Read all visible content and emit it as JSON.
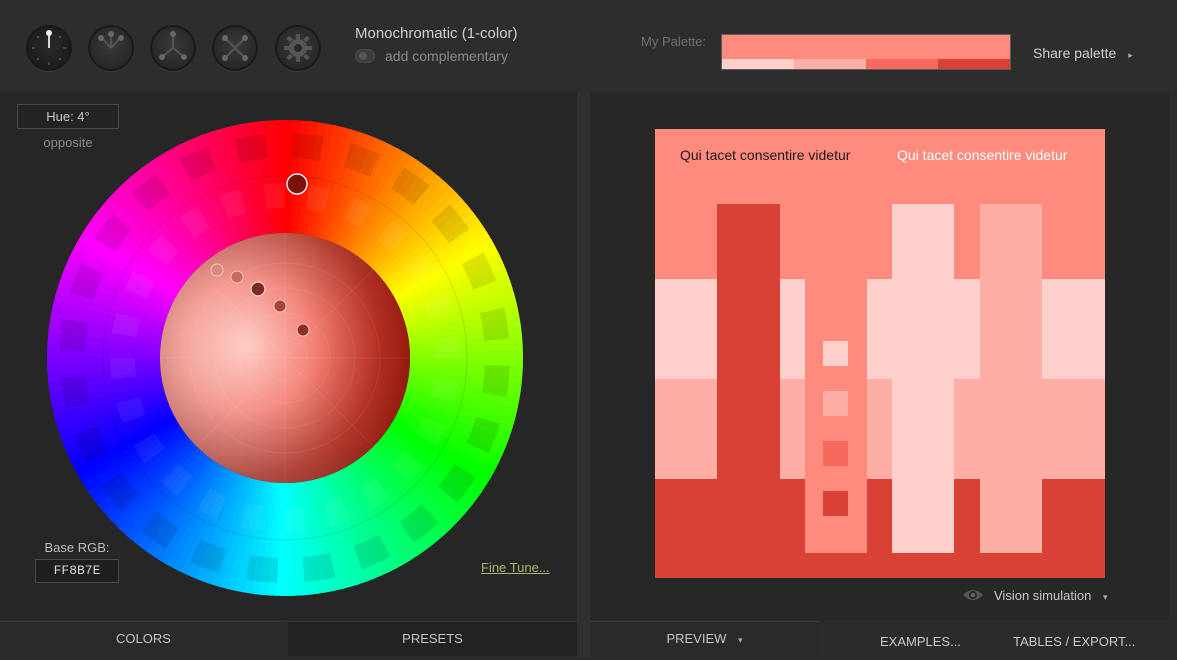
{
  "toolbar": {
    "scheme_buttons": [
      {
        "name": "mono-scheme",
        "active": true
      },
      {
        "name": "adjacent-scheme",
        "active": false
      },
      {
        "name": "triad-scheme",
        "active": false
      },
      {
        "name": "tetrad-scheme",
        "active": false
      },
      {
        "name": "free-style-scheme",
        "active": false
      }
    ],
    "scheme_title": "Monochromatic (1-color)",
    "add_complementary": "add complementary"
  },
  "palette": {
    "label": "My Palette:",
    "main_color": "#FF8B7E",
    "swatches": [
      "#FFD0CB",
      "#FFAEA5",
      "#F7695C",
      "#D84235"
    ],
    "share_label": "Share palette",
    "share_caret": "▸"
  },
  "colors_panel": {
    "hue_label": "Hue: 4°",
    "opposite_label": "opposite",
    "base_rgb_label": "Base RGB:",
    "base_rgb_value": "FF8B7E",
    "fine_tune_label": "Fine Tune..."
  },
  "preview": {
    "text": "Qui tacet consentire videtur",
    "text_colors": [
      "#1a1a1a",
      "#ffffff"
    ],
    "vision_label": "Vision simulation",
    "vision_caret": "▾"
  },
  "tabs": {
    "colors": "COLORS",
    "presets": "PRESETS",
    "preview": "PREVIEW",
    "preview_caret": "▾",
    "examples": "EXAMPLES...",
    "tables": "TABLES / EXPORT..."
  }
}
